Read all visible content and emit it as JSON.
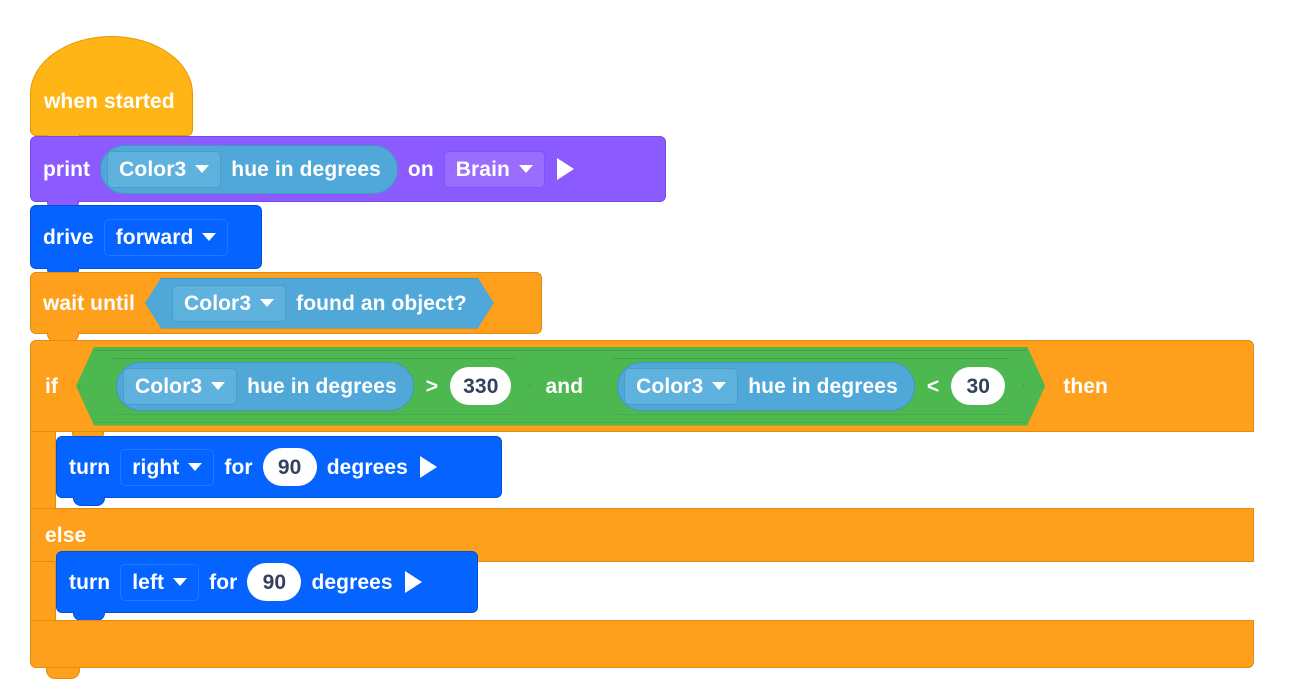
{
  "colors": {
    "events_orange": "#ffb515",
    "control_orange": "#ffa01c",
    "looks_purple": "#8c5bff",
    "motion_blue": "#0563ff",
    "sensing_blue": "#4fa8d8",
    "operator_green": "#4cb84f",
    "input_text": "#35405e",
    "block_text": "#ffffff"
  },
  "program": {
    "hat": {
      "label": "when started",
      "icon": "hat-block"
    },
    "print_block": {
      "command": "print",
      "sensor": {
        "device": "Color3",
        "property": "hue in degrees",
        "caret": "chevron-down-icon"
      },
      "on_label": "on",
      "target": {
        "value": "Brain",
        "caret": "chevron-down-icon"
      },
      "run_icon": "play-arrow-icon"
    },
    "drive_block": {
      "command": "drive",
      "direction": {
        "value": "forward",
        "caret": "chevron-down-icon"
      }
    },
    "wait_until_block": {
      "command": "wait until",
      "condition": {
        "device": "Color3",
        "property": "found an object?",
        "caret": "chevron-down-icon"
      }
    },
    "if_block": {
      "if_label": "if",
      "then_label": "then",
      "else_label": "else",
      "condition": {
        "operator": "and",
        "left": {
          "device": "Color3",
          "property": "hue in degrees",
          "comparator": ">",
          "value": "330"
        },
        "right": {
          "device": "Color3",
          "property": "hue in degrees",
          "comparator": "<",
          "value": "30"
        },
        "caret": "chevron-down-icon"
      },
      "then_body": {
        "command": "turn",
        "direction": {
          "value": "right",
          "caret": "chevron-down-icon"
        },
        "for_label": "for",
        "amount": "90",
        "units": "degrees",
        "run_icon": "play-arrow-icon"
      },
      "else_body": {
        "command": "turn",
        "direction": {
          "value": "left",
          "caret": "chevron-down-icon"
        },
        "for_label": "for",
        "amount": "90",
        "units": "degrees",
        "run_icon": "play-arrow-icon"
      }
    }
  }
}
